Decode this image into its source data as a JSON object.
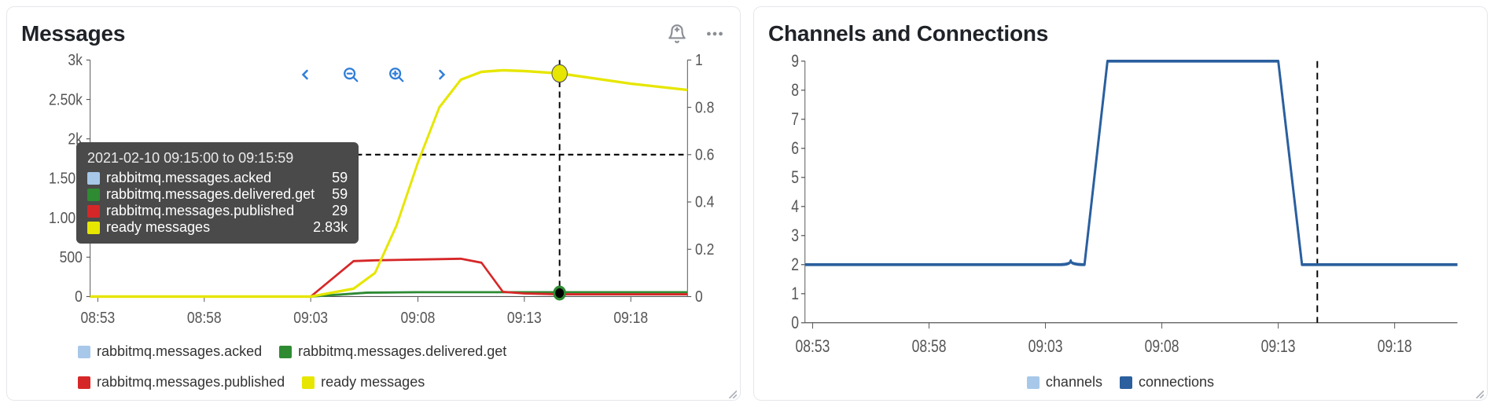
{
  "panels": {
    "messages": {
      "title": "Messages",
      "legend": [
        {
          "label": "rabbitmq.messages.acked",
          "color": "#a7c8e9"
        },
        {
          "label": "rabbitmq.messages.delivered.get",
          "color": "#2e8b32"
        },
        {
          "label": "rabbitmq.messages.published",
          "color": "#d62728"
        },
        {
          "label": "ready messages",
          "color": "#e6e600"
        }
      ]
    },
    "channels": {
      "title": "Channels and Connections",
      "legend": [
        {
          "label": "channels",
          "color": "#a7c8e9"
        },
        {
          "label": "connections",
          "color": "#2b5f9e"
        }
      ]
    }
  },
  "tooltip": {
    "title": "2021-02-10 09:15:00 to 09:15:59",
    "rows": [
      {
        "label": "rabbitmq.messages.acked",
        "value": "59",
        "color": "#a7c8e9"
      },
      {
        "label": "rabbitmq.messages.delivered.get",
        "value": "59",
        "color": "#2e8b32"
      },
      {
        "label": "rabbitmq.messages.published",
        "value": "29",
        "color": "#d62728"
      },
      {
        "label": "ready messages",
        "value": "2.83k",
        "color": "#e6e600"
      }
    ]
  },
  "chart_data": [
    {
      "type": "line",
      "title": "Messages",
      "x_categories": [
        "08:53",
        "08:58",
        "09:03",
        "09:08",
        "09:13",
        "09:18"
      ],
      "x_range": [
        "08:53",
        "09:21"
      ],
      "y_left": {
        "label": "",
        "ticks": [
          0,
          500,
          1000,
          1500,
          2000,
          2500,
          3000
        ],
        "tick_labels": [
          "0",
          "500",
          "1.00k",
          "1.50k",
          "2k",
          "2.50k",
          "3k"
        ],
        "range": [
          0,
          3000
        ]
      },
      "y_right": {
        "label": "",
        "ticks": [
          0,
          0.2,
          0.4,
          0.6,
          0.8,
          1
        ],
        "range": [
          0,
          1
        ]
      },
      "cursor_time": "09:15",
      "crosshair_y_left": 1800,
      "cursor_marker": {
        "series": "ready messages",
        "value": 2830
      },
      "series": [
        {
          "name": "rabbitmq.messages.acked",
          "axis": "left",
          "color": "#a7c8e9",
          "values": [
            [
              "08:53",
              0
            ],
            [
              "08:58",
              0
            ],
            [
              "09:03",
              0
            ],
            [
              "09:06",
              50
            ],
            [
              "09:08",
              55
            ],
            [
              "09:10",
              58
            ],
            [
              "09:13",
              59
            ],
            [
              "09:15",
              59
            ],
            [
              "09:18",
              59
            ],
            [
              "09:21",
              59
            ]
          ]
        },
        {
          "name": "rabbitmq.messages.delivered.get",
          "axis": "left",
          "color": "#2e8b32",
          "values": [
            [
              "08:53",
              0
            ],
            [
              "08:58",
              0
            ],
            [
              "09:03",
              0
            ],
            [
              "09:06",
              50
            ],
            [
              "09:08",
              55
            ],
            [
              "09:10",
              58
            ],
            [
              "09:13",
              59
            ],
            [
              "09:15",
              59
            ],
            [
              "09:18",
              59
            ],
            [
              "09:21",
              59
            ]
          ]
        },
        {
          "name": "rabbitmq.messages.published",
          "axis": "left",
          "color": "#d62728",
          "values": [
            [
              "08:53",
              0
            ],
            [
              "08:58",
              0
            ],
            [
              "09:03",
              0
            ],
            [
              "09:05",
              450
            ],
            [
              "09:06",
              460
            ],
            [
              "09:08",
              470
            ],
            [
              "09:10",
              480
            ],
            [
              "09:11",
              430
            ],
            [
              "09:12",
              60
            ],
            [
              "09:13",
              40
            ],
            [
              "09:15",
              29
            ],
            [
              "09:18",
              29
            ],
            [
              "09:21",
              29
            ]
          ]
        },
        {
          "name": "ready messages",
          "axis": "left",
          "color": "#e6e600",
          "values": [
            [
              "08:53",
              0
            ],
            [
              "08:58",
              0
            ],
            [
              "09:03",
              0
            ],
            [
              "09:05",
              100
            ],
            [
              "09:06",
              300
            ],
            [
              "09:07",
              900
            ],
            [
              "09:08",
              1700
            ],
            [
              "09:09",
              2400
            ],
            [
              "09:10",
              2750
            ],
            [
              "09:11",
              2850
            ],
            [
              "09:12",
              2870
            ],
            [
              "09:13",
              2860
            ],
            [
              "09:15",
              2830
            ],
            [
              "09:18",
              2700
            ],
            [
              "09:21",
              2620
            ]
          ]
        }
      ]
    },
    {
      "type": "line",
      "title": "Channels and Connections",
      "x_categories": [
        "08:53",
        "08:58",
        "09:03",
        "09:08",
        "09:13",
        "09:18"
      ],
      "x_range": [
        "08:53",
        "09:21"
      ],
      "y_left": {
        "label": "",
        "ticks": [
          0,
          1,
          2,
          3,
          4,
          5,
          6,
          7,
          8,
          9
        ],
        "range": [
          0,
          9
        ]
      },
      "cursor_time": "09:15",
      "series": [
        {
          "name": "channels",
          "color": "#a7c8e9",
          "values": [
            [
              "08:53",
              2
            ],
            [
              "09:03",
              2
            ],
            [
              "09:04",
              2
            ],
            [
              "09:05",
              2
            ],
            [
              "09:06",
              9
            ],
            [
              "09:13",
              9
            ],
            [
              "09:14",
              2
            ],
            [
              "09:21",
              2
            ]
          ]
        },
        {
          "name": "connections",
          "color": "#2b5f9e",
          "values": [
            [
              "08:53",
              2
            ],
            [
              "09:03",
              2
            ],
            [
              "09:04",
              2
            ],
            [
              "09:05",
              2
            ],
            [
              "09:06",
              9
            ],
            [
              "09:13",
              9
            ],
            [
              "09:14",
              2
            ],
            [
              "09:21",
              2
            ]
          ]
        }
      ]
    }
  ]
}
